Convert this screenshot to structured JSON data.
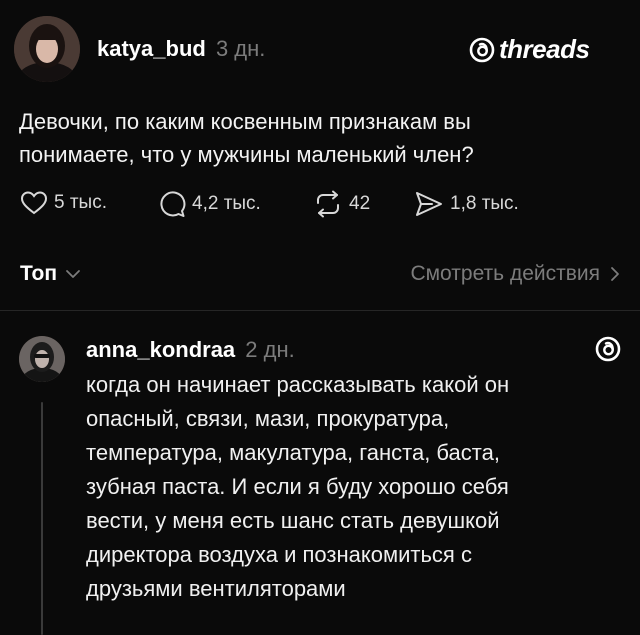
{
  "post": {
    "username": "katya_bud",
    "time": "3 дн.",
    "brand": "threads",
    "text_lines": [
      "Девочки, по каким косвенным признакам вы",
      "понимаете, что у мужчины маленький член?"
    ],
    "likes": "5 тыс.",
    "comments": "4,2 тыс.",
    "reposts": "42",
    "shares": "1,8 тыс."
  },
  "sort": {
    "label": "Топ",
    "view_activity": "Смотреть действия"
  },
  "reply": {
    "username": "anna_kondraa",
    "time": "2 дн.",
    "text_lines": [
      "когда он начинает рассказывать какой он",
      "опасный, связи, мази, прокуратура,",
      "температура, макулатура, ганста, баста,",
      "зубная паста. И если я буду хорошо себя",
      "вести, у меня есть шанс стать девушкой",
      "директора воздуха и познакомиться с",
      "друзьями вентиляторами"
    ]
  },
  "colors": {
    "background": "#0a0a0a",
    "text": "#f2f2f2",
    "muted": "#7c7c7c"
  }
}
